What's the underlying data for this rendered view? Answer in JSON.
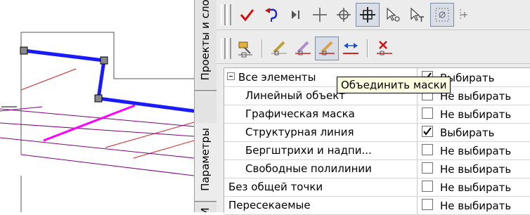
{
  "side_tabs": {
    "projects": "Проекты и слои",
    "parameters": "Параметры",
    "third": "И"
  },
  "toolbar1": {
    "buttons": [
      "check-icon",
      "undo-curve-icon",
      "step-icon",
      "plus-cross-icon",
      "crosshair-icon",
      "crosshair-pressed-icon",
      "select-arrow-o-icon",
      "select-arrow-t-icon",
      "snap-grid-icon",
      "more-icon"
    ]
  },
  "toolbar2": {
    "buttons": [
      "layer-tool-icon",
      "pen-mask-icon",
      "eraser-mask-icon",
      "merge-mask-icon",
      "join-arrows-icon",
      "delete-mask-icon"
    ]
  },
  "tooltip": "Объединить маски",
  "rows": [
    {
      "label": "Все элементы",
      "value": "Выбирать",
      "checked": true,
      "indent": false,
      "expander": true
    },
    {
      "label": "Линейный объект",
      "value": "Не выбирать",
      "checked": false,
      "indent": true,
      "expander": false
    },
    {
      "label": "Графическая маска",
      "value": "Не выбирать",
      "checked": false,
      "indent": true,
      "expander": false
    },
    {
      "label": "Структурная линия",
      "value": "Выбирать",
      "checked": true,
      "indent": true,
      "expander": false
    },
    {
      "label": "Бергштрихи и надпи...",
      "value": "Не выбирать",
      "checked": false,
      "indent": true,
      "expander": false
    },
    {
      "label": "Свободные полилинии",
      "value": "Не выбирать",
      "checked": false,
      "indent": true,
      "expander": false
    },
    {
      "label": "Без общей точки",
      "value": "Не выбирать",
      "checked": false,
      "indent": false,
      "expander": false
    },
    {
      "label": "Пересекаемые",
      "value": "Не выбирать",
      "checked": false,
      "indent": false,
      "expander": false
    }
  ],
  "colors": {
    "polyline": "#1a1aff",
    "hatch_red": "#d02020",
    "hatch_purple": "#800080",
    "magenta": "#ff00ff",
    "tooltip_bg": "#ffffe1"
  }
}
